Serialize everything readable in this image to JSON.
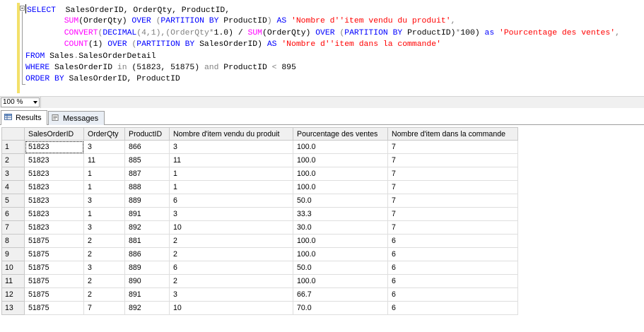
{
  "editor": {
    "lines": [
      [
        {
          "t": "SELECT",
          "c": "kw"
        },
        {
          "t": "  SalesOrderID, OrderQty, ProductID,",
          "c": ""
        }
      ],
      [
        {
          "t": "        ",
          "c": ""
        },
        {
          "t": "SUM",
          "c": "fn"
        },
        {
          "t": "(OrderQty) ",
          "c": ""
        },
        {
          "t": "OVER",
          "c": "kw"
        },
        {
          "t": " (",
          "c": "gr"
        },
        {
          "t": "PARTITION BY",
          "c": "kw"
        },
        {
          "t": " ProductID",
          "c": ""
        },
        {
          "t": ")",
          "c": "gr"
        },
        {
          "t": " AS ",
          "c": "kw"
        },
        {
          "t": "'Nombre d''item vendu du produit'",
          "c": "str"
        },
        {
          "t": ",",
          "c": "gr"
        }
      ],
      [
        {
          "t": "        ",
          "c": ""
        },
        {
          "t": "CONVERT",
          "c": "fn"
        },
        {
          "t": "(",
          "c": "gr"
        },
        {
          "t": "DECIMAL",
          "c": "kw"
        },
        {
          "t": "(4,1),(OrderQty",
          "c": "gr"
        },
        {
          "t": "*",
          "c": "gr"
        },
        {
          "t": "1.0) / ",
          "c": ""
        },
        {
          "t": "SUM",
          "c": "fn"
        },
        {
          "t": "(OrderQty) ",
          "c": ""
        },
        {
          "t": "OVER",
          "c": "kw"
        },
        {
          "t": " (",
          "c": "gr"
        },
        {
          "t": "PARTITION BY",
          "c": "kw"
        },
        {
          "t": " ProductID)",
          "c": ""
        },
        {
          "t": "*",
          "c": "gr"
        },
        {
          "t": "100) ",
          "c": ""
        },
        {
          "t": "as",
          "c": "kw"
        },
        {
          "t": " ",
          "c": ""
        },
        {
          "t": "'Pourcentage des ventes'",
          "c": "str"
        },
        {
          "t": ",",
          "c": "gr"
        }
      ],
      [
        {
          "t": "        ",
          "c": ""
        },
        {
          "t": "COUNT",
          "c": "fn"
        },
        {
          "t": "(1) ",
          "c": ""
        },
        {
          "t": "OVER",
          "c": "kw"
        },
        {
          "t": " (",
          "c": "gr"
        },
        {
          "t": "PARTITION BY",
          "c": "kw"
        },
        {
          "t": " SalesOrderID) ",
          "c": ""
        },
        {
          "t": "AS",
          "c": "kw"
        },
        {
          "t": " ",
          "c": ""
        },
        {
          "t": "'Nombre d''item dans la commande'",
          "c": "str"
        }
      ],
      [
        {
          "t": "FROM",
          "c": "kw"
        },
        {
          "t": " Sales",
          "c": ""
        },
        {
          "t": ".",
          "c": "gr"
        },
        {
          "t": "SalesOrderDetail",
          "c": ""
        }
      ],
      [
        {
          "t": "WHERE",
          "c": "kw"
        },
        {
          "t": " SalesOrderID ",
          "c": ""
        },
        {
          "t": "in",
          "c": "gr"
        },
        {
          "t": " (51823, 51875) ",
          "c": ""
        },
        {
          "t": "and",
          "c": "gr"
        },
        {
          "t": " ProductID ",
          "c": ""
        },
        {
          "t": "<",
          "c": "gr"
        },
        {
          "t": " 895",
          "c": ""
        }
      ],
      [
        {
          "t": "ORDER BY",
          "c": "kw"
        },
        {
          "t": " SalesOrderID, ProductID",
          "c": ""
        }
      ]
    ]
  },
  "zoom": {
    "value": "100 %"
  },
  "tabs": {
    "results": "Results",
    "messages": "Messages"
  },
  "grid": {
    "columns": [
      "SalesOrderID",
      "OrderQty",
      "ProductID",
      "Nombre d'item vendu du produit",
      "Pourcentage des ventes",
      "Nombre d'item dans la commande"
    ],
    "rows": [
      [
        "1",
        "51823",
        "3",
        "866",
        "3",
        "100.0",
        "7"
      ],
      [
        "2",
        "51823",
        "11",
        "885",
        "11",
        "100.0",
        "7"
      ],
      [
        "3",
        "51823",
        "1",
        "887",
        "1",
        "100.0",
        "7"
      ],
      [
        "4",
        "51823",
        "1",
        "888",
        "1",
        "100.0",
        "7"
      ],
      [
        "5",
        "51823",
        "3",
        "889",
        "6",
        "50.0",
        "7"
      ],
      [
        "6",
        "51823",
        "1",
        "891",
        "3",
        "33.3",
        "7"
      ],
      [
        "7",
        "51823",
        "3",
        "892",
        "10",
        "30.0",
        "7"
      ],
      [
        "8",
        "51875",
        "2",
        "881",
        "2",
        "100.0",
        "6"
      ],
      [
        "9",
        "51875",
        "2",
        "886",
        "2",
        "100.0",
        "6"
      ],
      [
        "10",
        "51875",
        "3",
        "889",
        "6",
        "50.0",
        "6"
      ],
      [
        "11",
        "51875",
        "2",
        "890",
        "2",
        "100.0",
        "6"
      ],
      [
        "12",
        "51875",
        "2",
        "891",
        "3",
        "66.7",
        "6"
      ],
      [
        "13",
        "51875",
        "7",
        "892",
        "10",
        "70.0",
        "6"
      ]
    ]
  }
}
